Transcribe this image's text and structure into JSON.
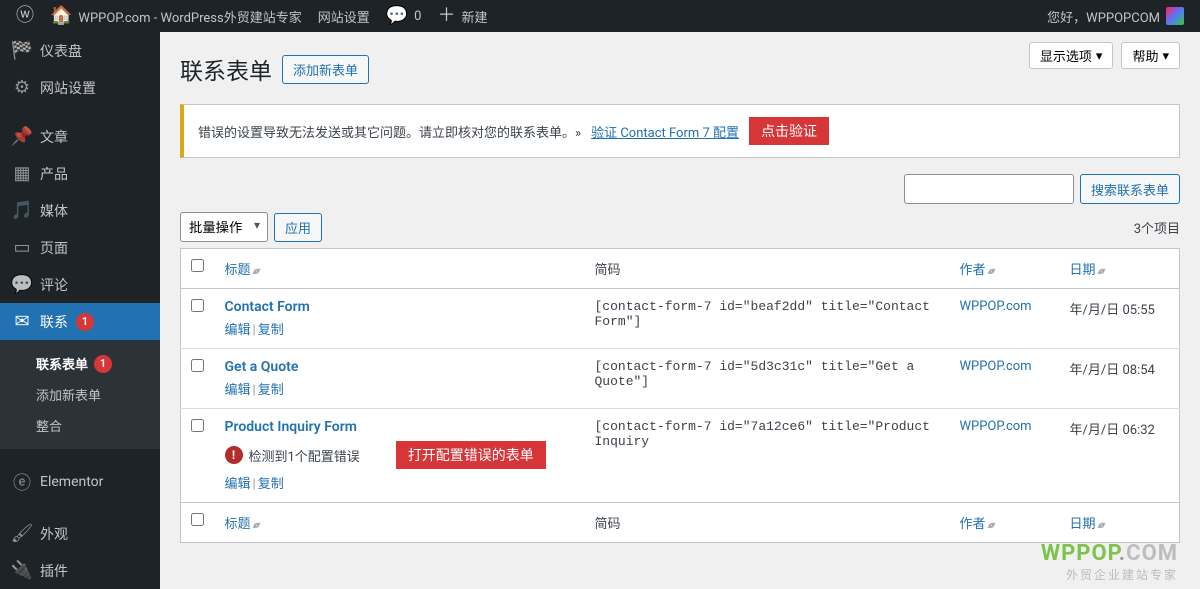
{
  "adminbar": {
    "site_title": "WPPOP.com - WordPress外贸建站专家",
    "site_settings": "网站设置",
    "comments_count": "0",
    "new_label": "新建",
    "greeting": "您好，WPPOPCOM"
  },
  "sidebar": {
    "items": [
      {
        "label": "仪表盘",
        "icon": "speed"
      },
      {
        "label": "网站设置",
        "icon": "gear"
      },
      {
        "label": "文章",
        "icon": "pin"
      },
      {
        "label": "产品",
        "icon": "grid"
      },
      {
        "label": "媒体",
        "icon": "media"
      },
      {
        "label": "页面",
        "icon": "page"
      },
      {
        "label": "评论",
        "icon": "comment"
      },
      {
        "label": "联系",
        "icon": "mail",
        "badge": "1",
        "current": true
      },
      {
        "label": "Elementor",
        "icon": "elementor"
      },
      {
        "label": "外观",
        "icon": "brush"
      },
      {
        "label": "插件",
        "icon": "plug"
      }
    ],
    "submenu": [
      {
        "label": "联系表单",
        "badge": "1",
        "current": true
      },
      {
        "label": "添加新表单"
      },
      {
        "label": "整合"
      }
    ]
  },
  "screen": {
    "options": "显示选项",
    "help": "帮助"
  },
  "page": {
    "title": "联系表单",
    "add_new": "添加新表单"
  },
  "notice": {
    "text": "错误的设置导致无法发送或其它问题。请立即核对您的联系表单。»",
    "link": "验证 Contact Form 7 配置",
    "callout": "点击验证"
  },
  "search": {
    "button": "搜索联系表单",
    "placeholder": ""
  },
  "bulk": {
    "select_label": "批量操作",
    "apply": "应用"
  },
  "count_label": "3个项目",
  "columns": {
    "title": "标题",
    "shortcode": "简码",
    "author": "作者",
    "date": "日期"
  },
  "row_actions": {
    "edit": "编辑",
    "duplicate": "复制"
  },
  "config_error": {
    "text": "检测到1个配置错误",
    "callout": "打开配置错误的表单"
  },
  "rows": [
    {
      "title": "Contact Form",
      "shortcode": "[contact-form-7 id=\"beaf2dd\" title=\"Contact Form\"]",
      "author": "WPPOP.com",
      "date": "年/月/日 05:55"
    },
    {
      "title": "Get a Quote",
      "shortcode": "[contact-form-7 id=\"5d3c31c\" title=\"Get a Quote\"]",
      "author": "WPPOP.com",
      "date": "年/月/日 08:54"
    },
    {
      "title": "Product Inquiry Form",
      "shortcode": "[contact-form-7 id=\"7a12ce6\" title=\"Product Inquiry",
      "author": "WPPOP.com",
      "date": "年/月/日 06:32",
      "has_error": true
    }
  ],
  "watermark": {
    "line1a": "WPPOP",
    "line1b": ".",
    "line1c": "COM",
    "line2": "外贸企业建站专家"
  }
}
